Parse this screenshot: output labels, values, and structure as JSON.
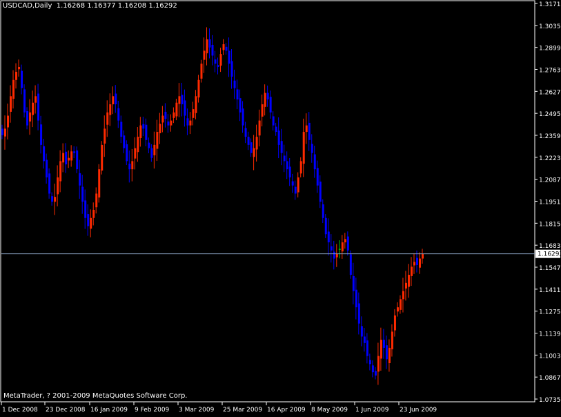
{
  "header": {
    "symbol": "USDCAD,Daily",
    "ohlc": "1.16268 1.16377 1.16208 1.16292"
  },
  "footer": {
    "copyright": "MetaTrader, ? 2001-2009 MetaQuotes Software Corp."
  },
  "colors": {
    "background": "#000000",
    "frame": "#ffffff",
    "bull": "#ff2a00",
    "bear": "#0000ff",
    "doji": "#00c800",
    "bid_line": "#8ea6c8",
    "price_tag_bg": "#ffffff",
    "price_tag_fg": "#000000",
    "axis_text": "#ffffff"
  },
  "chart_data": {
    "type": "candlestick",
    "symbol": "USDCAD",
    "timeframe": "Daily",
    "ylim": [
      1.0735,
      1.3171
    ],
    "y_ticks": [
      "1.31710",
      "1.30350",
      "1.28990",
      "1.27630",
      "1.26270",
      "1.24950",
      "1.23590",
      "1.22230",
      "1.20870",
      "1.19510",
      "1.18150",
      "1.16830",
      "1.15470",
      "1.14110",
      "1.12750",
      "1.11390",
      "1.10030",
      "1.08670",
      "1.07350"
    ],
    "x_ticks": [
      "1 Dec 2008",
      "23 Dec 2008",
      "16 Jan 2009",
      "9 Feb 2009",
      "3 Mar 2009",
      "25 Mar 2009",
      "16 Apr 2009",
      "8 May 2009",
      "1 Jun 2009",
      "23 Jun 2009"
    ],
    "current_price": "1.16292",
    "bar_count": 153,
    "closes": [
      1.236,
      1.24,
      1.248,
      1.26,
      1.27,
      1.275,
      1.278,
      1.265,
      1.25,
      1.242,
      1.25,
      1.256,
      1.26,
      1.245,
      1.23,
      1.22,
      1.21,
      1.2,
      1.195,
      1.198,
      1.21,
      1.22,
      1.225,
      1.218,
      1.222,
      1.226,
      1.225,
      1.215,
      1.205,
      1.195,
      1.185,
      1.18,
      1.185,
      1.19,
      1.2,
      1.215,
      1.23,
      1.24,
      1.25,
      1.255,
      1.26,
      1.255,
      1.245,
      1.235,
      1.228,
      1.22,
      1.215,
      1.22,
      1.228,
      1.235,
      1.242,
      1.24,
      1.233,
      1.228,
      1.222,
      1.23,
      1.238,
      1.243,
      1.248,
      1.246,
      1.242,
      1.245,
      1.25,
      1.256,
      1.26,
      1.255,
      1.248,
      1.242,
      1.245,
      1.252,
      1.26,
      1.27,
      1.28,
      1.288,
      1.295,
      1.29,
      1.285,
      1.28,
      1.278,
      1.286,
      1.292,
      1.288,
      1.28,
      1.272,
      1.265,
      1.258,
      1.25,
      1.242,
      1.235,
      1.23,
      1.225,
      1.228,
      1.235,
      1.245,
      1.255,
      1.262,
      1.258,
      1.25,
      1.242,
      1.238,
      1.23,
      1.225,
      1.22,
      1.215,
      1.21,
      1.205,
      1.2,
      1.21,
      1.22,
      1.238,
      1.242,
      1.233,
      1.225,
      1.215,
      1.205,
      1.195,
      1.185,
      1.175,
      1.17,
      1.165,
      1.16,
      1.163,
      1.166,
      1.17,
      1.172,
      1.165,
      1.15,
      1.14,
      1.13,
      1.12,
      1.112,
      1.108,
      1.1,
      1.095,
      1.09,
      1.088,
      1.1,
      1.11,
      1.105,
      1.098,
      1.105,
      1.115,
      1.125,
      1.13,
      1.135,
      1.14,
      1.145,
      1.15,
      1.155,
      1.158,
      1.156,
      1.16,
      1.1629
    ]
  }
}
